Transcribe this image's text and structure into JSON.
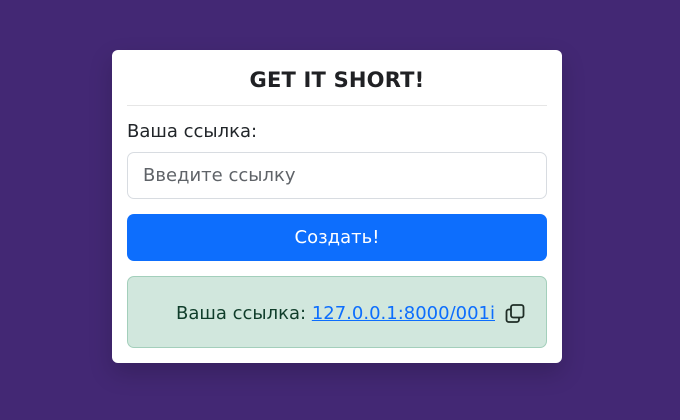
{
  "card": {
    "title": "GET IT SHORT!",
    "label": "Ваша ссылка:",
    "input_placeholder": "Введите ссылку",
    "input_value": "",
    "button_label": "Создать!",
    "result": {
      "prefix": "Ваша ссылка:",
      "link": "127.0.0.1:8000/001i",
      "copy_icon": "copy-icon"
    }
  },
  "colors": {
    "background": "#432874",
    "card": "#ffffff",
    "primary": "#0d6efd",
    "success_background": "#d1e7dd",
    "success_border": "#a3cfbb",
    "success_text": "#0f3d2a"
  }
}
